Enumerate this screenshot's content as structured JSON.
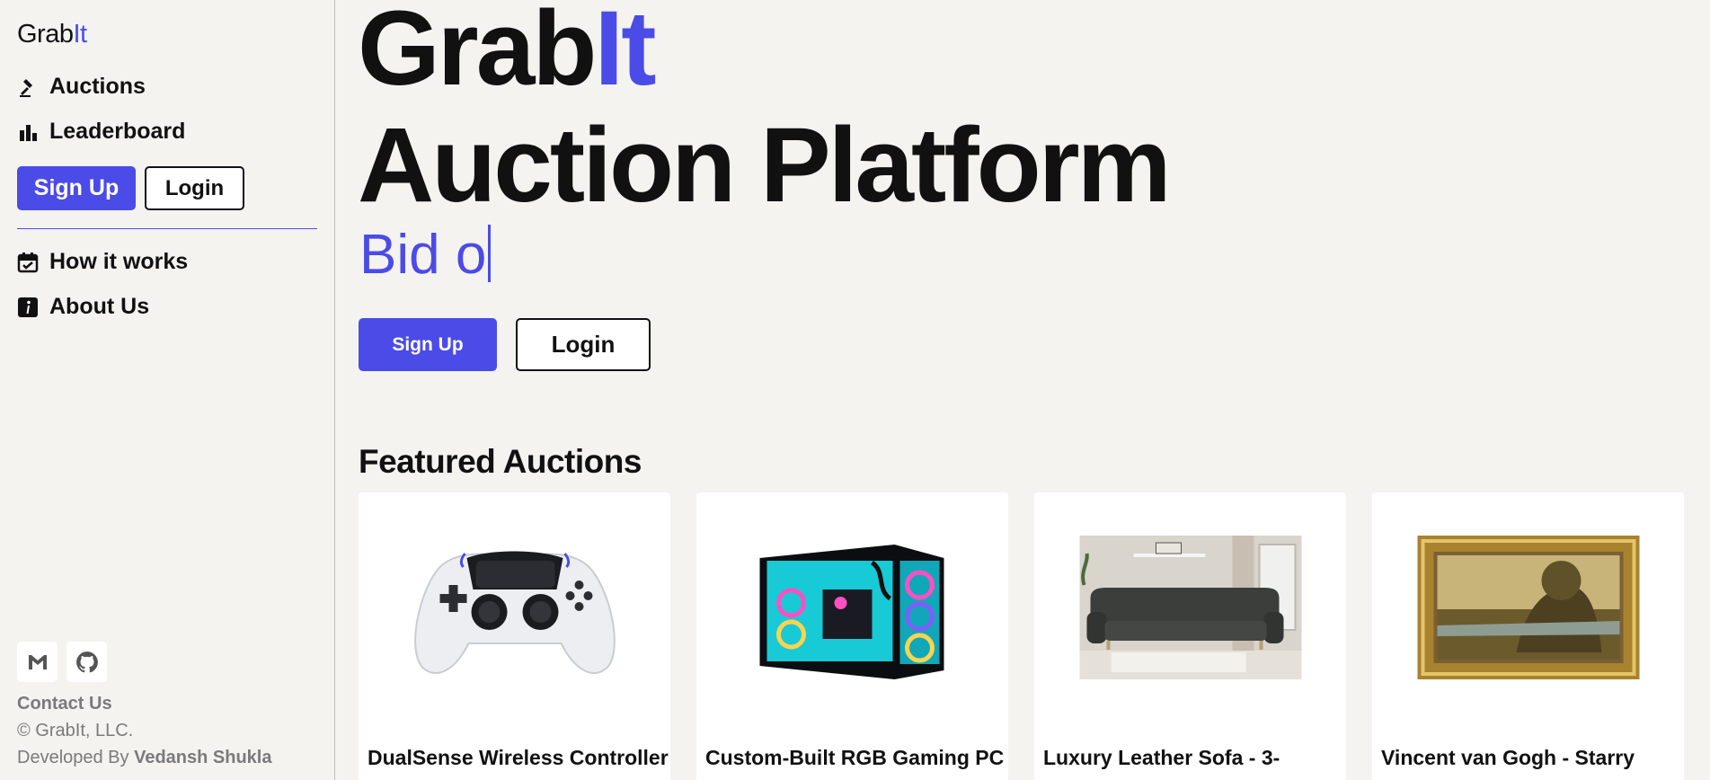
{
  "brand": {
    "name_a": "Grab",
    "name_b": "It"
  },
  "sidebar": {
    "nav": [
      {
        "label": "Auctions",
        "icon": "gavel-icon"
      },
      {
        "label": "Leaderboard",
        "icon": "bar-chart-icon"
      }
    ],
    "signup_label": "Sign Up",
    "login_label": "Login",
    "nav2": [
      {
        "label": "How it works",
        "icon": "calendar-check-icon"
      },
      {
        "label": "About Us",
        "icon": "info-icon"
      }
    ]
  },
  "footer": {
    "contact": "Contact Us",
    "copyright": "© GrabIt, LLC.",
    "developed_prefix": "Developed By ",
    "developer": "Vedansh Shukla",
    "social": [
      "gmail-icon",
      "github-icon"
    ]
  },
  "hero": {
    "line1_a": "Grab",
    "line1_b": "It",
    "line2": "Auction Platform",
    "typing": "Bid o",
    "signup_label": "Sign Up",
    "login_label": "Login"
  },
  "featured": {
    "title": "Featured Auctions",
    "cards": [
      {
        "title": "DualSense Wireless Controller"
      },
      {
        "title": "Custom-Built RGB Gaming PC"
      },
      {
        "title": "Luxury Leather Sofa - 3-"
      },
      {
        "title": "Vincent van Gogh - Starry"
      }
    ]
  },
  "colors": {
    "accent": "#4b4be8",
    "background": "#f4f3f0",
    "text": "#111111",
    "muted": "#7a7a7a"
  }
}
